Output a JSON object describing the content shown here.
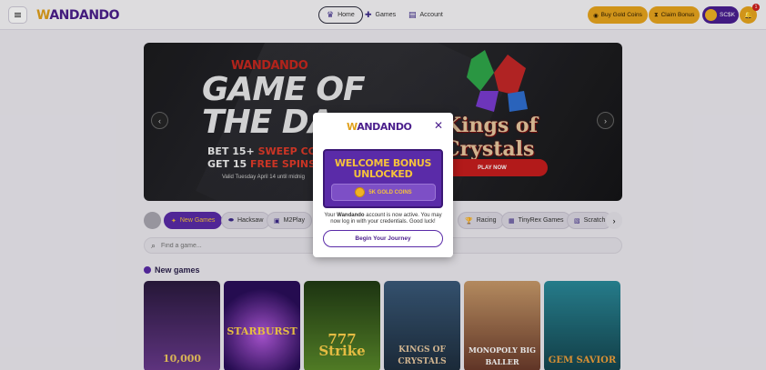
{
  "header": {
    "brand": {
      "prefix": "W",
      "rest": "ANDANDO"
    },
    "nav": [
      {
        "label": "Home",
        "icon": "crown-icon"
      },
      {
        "label": "Games",
        "icon": "gamepad-icon"
      },
      {
        "label": "Account",
        "icon": "id-card-icon"
      }
    ],
    "buy_label": "Buy Gold Coins",
    "claim_label": "Claim Bonus",
    "balance_label": "SC$K",
    "notification_count": "1"
  },
  "hero": {
    "brand": "WANDANDO",
    "title_line1": "GAME OF",
    "title_line2": "THE DA",
    "line1_prefix": "BET 15+ ",
    "line1_highlight": "SWEEP COINS T",
    "line2_prefix": "GET 15 ",
    "line2_highlight": "FREE SPINS TOM",
    "valid_text": "Valid Tuesday April 14 until midnig",
    "game_title": "Kings of Crystals",
    "play_label": "PLAY NOW"
  },
  "categories": [
    {
      "label": "New Games",
      "icon": "sparkle-icon",
      "active": true
    },
    {
      "label": "Hacksaw",
      "icon": "saw-icon"
    },
    {
      "label": "M2Play",
      "icon": "controller-icon"
    },
    {
      "label": "Racing",
      "icon": "trophy-icon"
    },
    {
      "label": "TinyRex Games",
      "icon": "grid-icon"
    },
    {
      "label": "Scratch",
      "icon": "ticket-icon"
    }
  ],
  "search": {
    "placeholder": "Find a game..."
  },
  "new_games": {
    "title": "New games",
    "tiles": [
      {
        "title": "10,000",
        "bg": "#4a2a6a"
      },
      {
        "title": "STARBURST",
        "bg": "#3a1a6e"
      },
      {
        "title": "777 Strike",
        "bg": "#3f5f1e"
      },
      {
        "title": "KINGS OF CRYSTALS",
        "bg": "#2e4a6a"
      },
      {
        "title": "MONOPOLY BIG BALLER",
        "bg": "#a86a4a"
      },
      {
        "title": "GEM SAVIOR",
        "bg": "#2a7a8a"
      }
    ]
  },
  "modal": {
    "brand": {
      "prefix": "W",
      "rest": "ANDANDO"
    },
    "heading_line1": "WELCOME BONUS",
    "heading_line2": "UNLOCKED",
    "coins_label": "5K GOLD COINS",
    "message_prefix": "Your ",
    "message_brand": "Wandando",
    "message_suffix": " account is now active. You may now log in with your credentials. Good luck!",
    "button_label": "Begin Your Journey"
  },
  "colors": {
    "brand_purple": "#5a2ba8",
    "brand_gold": "#e8a51e",
    "hero_red": "#c71d1d"
  }
}
